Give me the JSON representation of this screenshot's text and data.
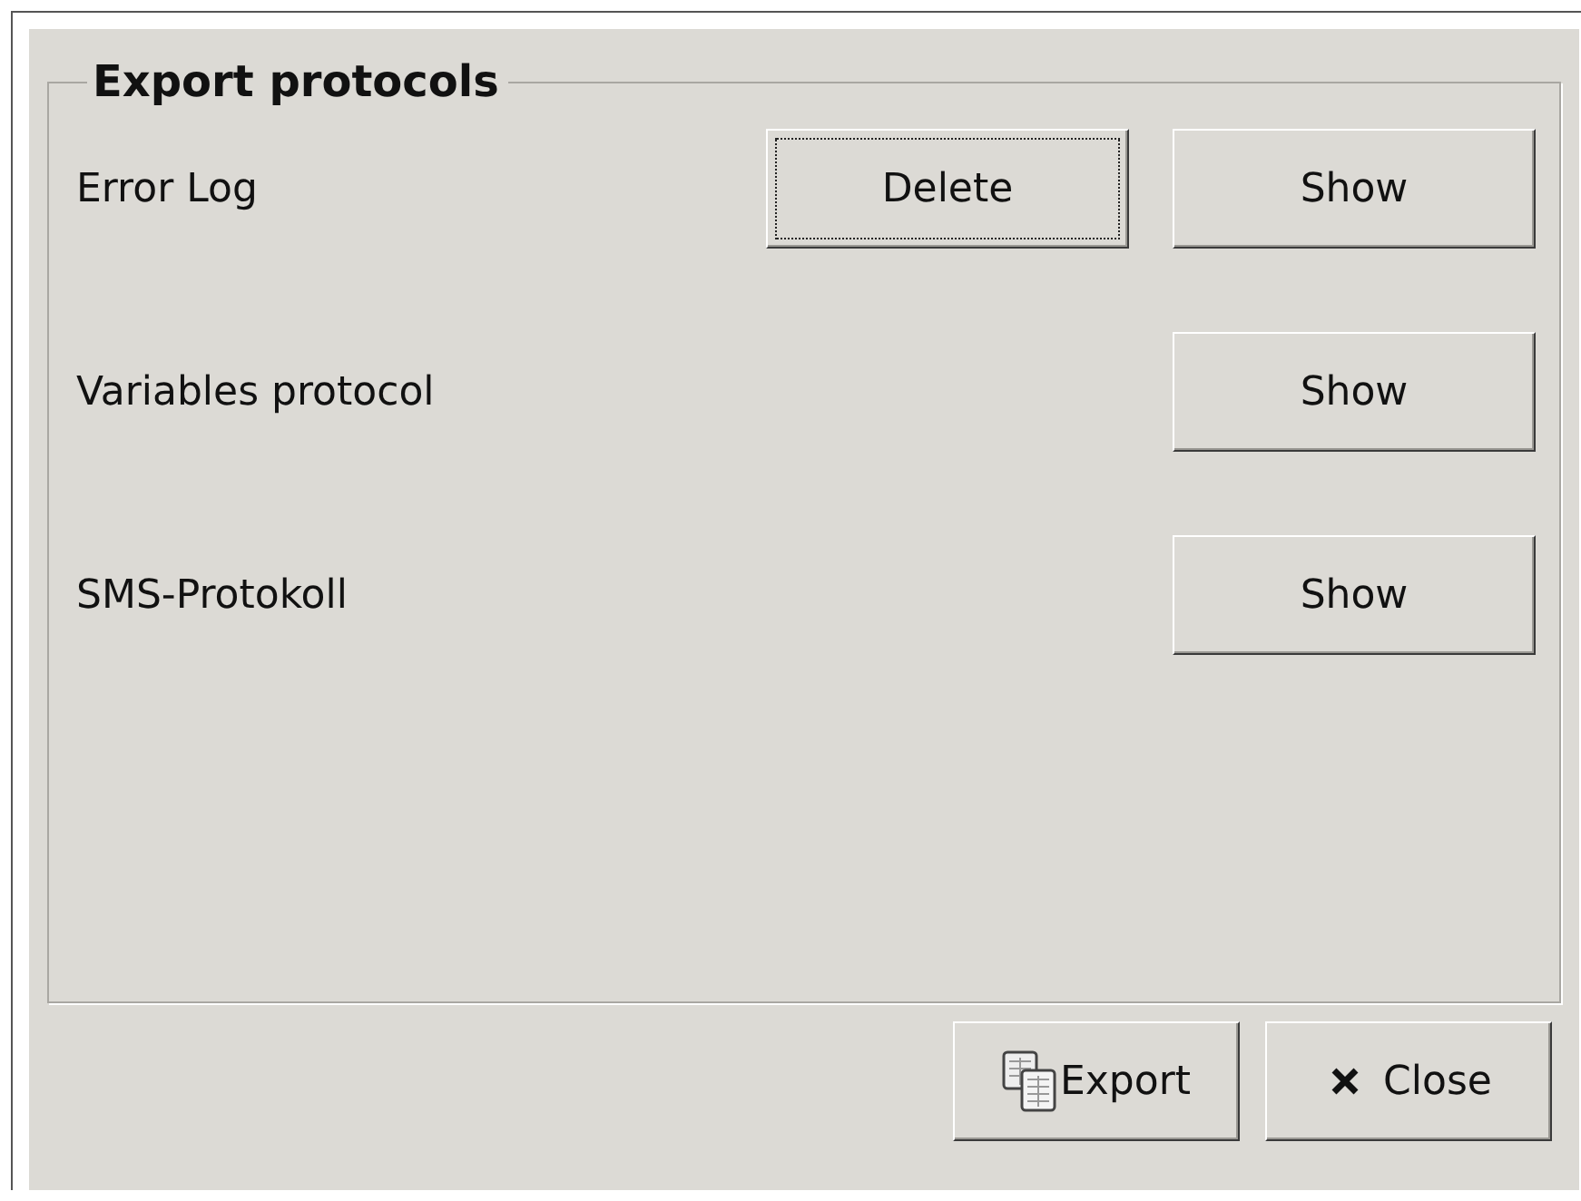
{
  "group": {
    "title": "Export protocols"
  },
  "rows": [
    {
      "label": "Error Log",
      "buttons": [
        {
          "label": "Delete",
          "focused": true
        },
        {
          "label": "Show",
          "focused": false
        }
      ]
    },
    {
      "label": "Variables protocol",
      "buttons": [
        {
          "label": "Show",
          "focused": false
        }
      ]
    },
    {
      "label": "SMS-Protokoll",
      "buttons": [
        {
          "label": "Show",
          "focused": false
        }
      ]
    }
  ],
  "footer_buttons": [
    {
      "kind": "export",
      "label": "Export"
    },
    {
      "kind": "close",
      "label": "Close"
    }
  ]
}
